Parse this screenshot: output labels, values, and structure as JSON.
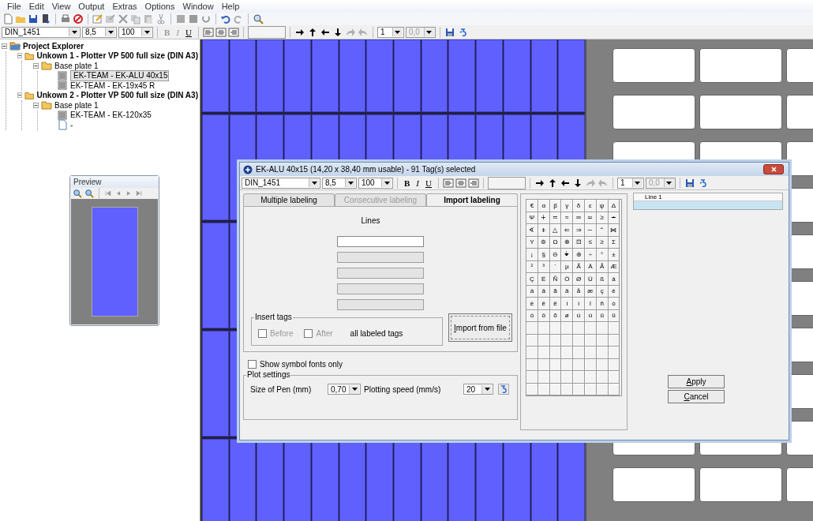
{
  "menu": [
    "File",
    "Edit",
    "View",
    "Output",
    "Extras",
    "Options",
    "Window",
    "Help"
  ],
  "toolbar": {
    "font": "DIN_1451",
    "size": "8,5",
    "scale": "100",
    "format_buttons": [
      {
        "label": "B",
        "disabled": true
      },
      {
        "label": "I",
        "disabled": true
      },
      {
        "label": "U",
        "disabled": false
      }
    ],
    "count": "1",
    "offset": {
      "value": "0,0",
      "disabled": true
    }
  },
  "project_explorer": {
    "items": [
      {
        "label": "Project Explorer",
        "kind": "project",
        "expanded": true,
        "selected": false,
        "children": [
          {
            "label": "Unkown 1 - Plotter VP 500 full size (DIN A3)",
            "kind": "folder",
            "expanded": true,
            "selected": false,
            "children": [
              {
                "label": "Base plate 1",
                "kind": "folder",
                "expanded": true,
                "selected": false,
                "children": [
                  {
                    "label": "EK-TEAM - EK-ALU 40x15",
                    "kind": "document",
                    "selected": true
                  },
                  {
                    "label": "EK-TEAM - EK-19x45 R",
                    "kind": "document",
                    "selected": false
                  }
                ]
              }
            ]
          },
          {
            "label": "Unkown 2 - Plotter VP 500 full size (DIN A3)",
            "kind": "folder",
            "expanded": true,
            "selected": false,
            "children": [
              {
                "label": "Base plate 1",
                "kind": "folder",
                "expanded": true,
                "selected": false,
                "children": [
                  {
                    "label": "EK-TEAM - EK-120x35",
                    "kind": "document",
                    "selected": false
                  },
                  {
                    "label": "-",
                    "kind": "blank",
                    "selected": false
                  }
                ]
              }
            ]
          }
        ]
      }
    ]
  },
  "preview": {
    "title": "Preview"
  },
  "dialog": {
    "title": "EK-ALU 40x15 (14,20 x 38,40 mm usable) - 91 Tag(s) selected",
    "toolbar": {
      "font": "DIN_1451",
      "size": "8,5",
      "scale": "100",
      "format_buttons": [
        {
          "label": "B",
          "disabled": false
        },
        {
          "label": "I",
          "disabled": false
        },
        {
          "label": "U",
          "disabled": false
        }
      ],
      "count": "1",
      "offset": {
        "value": "0,0",
        "disabled": true
      }
    },
    "tabs": [
      {
        "label": "Multiple labeling",
        "selected": false,
        "disabled": false
      },
      {
        "label": "Consecutive labeling",
        "selected": false,
        "disabled": true
      },
      {
        "label": "Import labeling",
        "selected": true,
        "disabled": false
      }
    ],
    "lines_label": "Lines",
    "lines": [
      {
        "disabled": false
      },
      {
        "disabled": true
      },
      {
        "disabled": true
      },
      {
        "disabled": true
      },
      {
        "disabled": true
      }
    ],
    "insert_tags": {
      "title": "Insert tags",
      "options": [
        {
          "label": "Before",
          "checked": false,
          "disabled": true
        },
        {
          "label": "After",
          "checked": false,
          "disabled": true
        }
      ],
      "note": "all labeled tags"
    },
    "import_button": "Import from file",
    "show_symbol_fonts": {
      "label": "Show symbol fonts only",
      "checked": false
    },
    "plot_settings": {
      "title": "Plot settings",
      "pen_label": "Size of Pen (mm)",
      "pen_value": "0,70",
      "speed_label": "Plotting speed (mm/s)",
      "speed_value": "20"
    },
    "symbols": [
      [
        "€",
        "α",
        "β",
        "γ",
        "δ",
        "ε",
        "ψ",
        "Δ"
      ],
      [
        "Ψ",
        "∔",
        "≂",
        "≈",
        "═",
        "≃",
        "≥",
        "∸"
      ],
      [
        "∢",
        "ǂ",
        "△",
        "⇐",
        "⇒",
        "∼",
        "⌃",
        "⋈"
      ],
      [
        "Υ",
        "⊜",
        "Ω",
        "⊗",
        "⊡",
        "≤",
        "≥",
        "Σ"
      ],
      [
        "¡",
        "§",
        "⊖",
        "⏚",
        "⊕",
        "÷",
        "°",
        "±"
      ],
      [
        "²",
        "³",
        "´",
        "µ",
        "Ã",
        "Ä",
        "Å",
        "Æ"
      ],
      [
        "Ç",
        "Ë",
        "Ñ",
        "Ö",
        "Ø",
        "Ü",
        "ß",
        "à"
      ],
      [
        "á",
        "â",
        "ã",
        "ä",
        "å",
        "æ",
        "ç",
        "è"
      ],
      [
        "é",
        "ê",
        "ë",
        "ì",
        "í",
        "î",
        "ñ",
        "ò"
      ],
      [
        "ó",
        "ô",
        "õ",
        "ø",
        "ù",
        "ú",
        "û",
        "ü"
      ]
    ],
    "line_list": {
      "header": "Line 1",
      "rows": [
        {
          "selected": true
        }
      ]
    },
    "buttons": [
      "Apply",
      "Cancel"
    ]
  }
}
